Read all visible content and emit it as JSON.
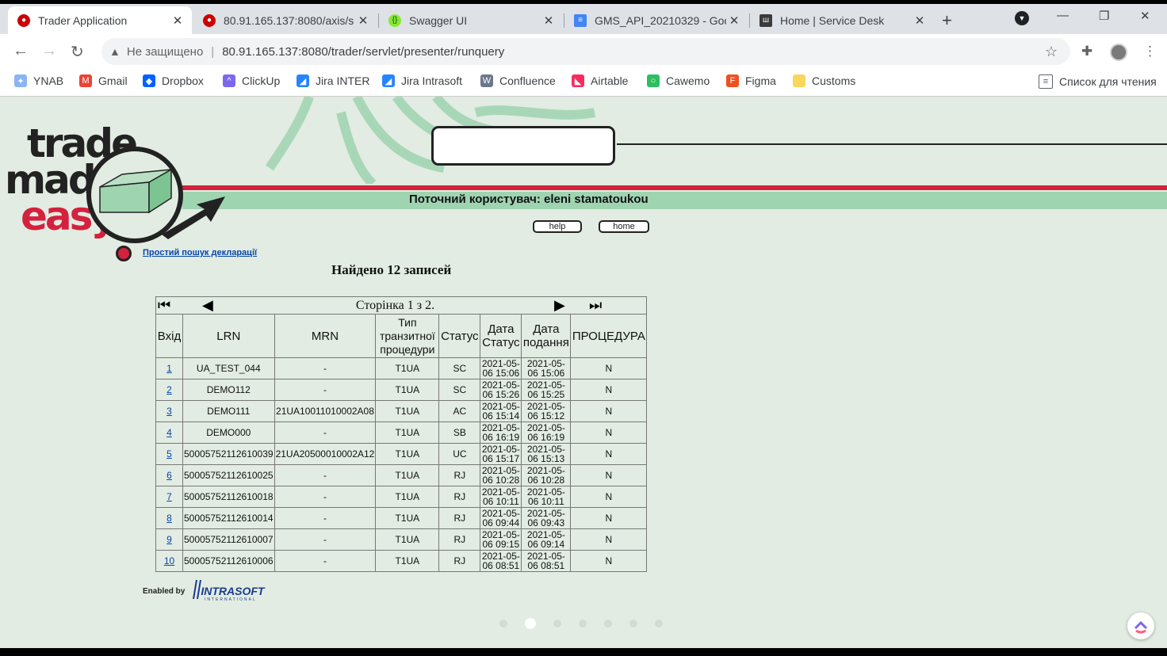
{
  "tabs": [
    {
      "title": "Trader Application",
      "icon": "redhat-icon"
    },
    {
      "title": "80.91.165.137:8080/axis/s",
      "icon": "redhat-icon"
    },
    {
      "title": "Swagger UI",
      "icon": "swagger-icon"
    },
    {
      "title": "GMS_API_20210329 - Goo",
      "icon": "docs-icon"
    },
    {
      "title": "Home | Service Desk",
      "icon": "servicedesk-icon"
    }
  ],
  "toolbar": {
    "security": "Не защищено",
    "url": "80.91.165.137:8080/trader/servlet/presenter/runquery"
  },
  "bookmarks": [
    {
      "label": "YNAB",
      "color": "#8ab4f8"
    },
    {
      "label": "Gmail",
      "color": "#ea4335"
    },
    {
      "label": "Dropbox",
      "color": "#0061ff"
    },
    {
      "label": "ClickUp",
      "color": "#7b68ee"
    },
    {
      "label": "Jira INTER",
      "color": "#2684ff"
    },
    {
      "label": "Jira Intrasoft",
      "color": "#2684ff"
    },
    {
      "label": "Confluence",
      "color": "#6b778c"
    },
    {
      "label": "Airtable",
      "color": "#f82b60"
    },
    {
      "label": "Cawemo",
      "color": "#2dbe60"
    },
    {
      "label": "Figma",
      "color": "#f24e1e"
    },
    {
      "label": "Customs",
      "color": "#f9d65c"
    }
  ],
  "reading_list": "Список для чтения",
  "app": {
    "logo_line1": "trade",
    "logo_line2": "made",
    "logo_line3": "easy",
    "current_user": "Поточний користувач: eleni stamatoukou",
    "help_label": "help",
    "home_label": "home",
    "simple_search_link": "Простий пошук декларації",
    "found_text": "Найдено 12 записей",
    "pager_text": "Сторінка 1 з 2.",
    "enabled_by": "Enabled by",
    "brand": "INTRASOFT",
    "brand_sub": "INTERNATIONAL"
  },
  "table": {
    "headers": [
      "Вхід",
      "LRN",
      "MRN",
      "Тип транзитної процедури",
      "Статус",
      "Дата Статус",
      "Дата подання",
      "ПРОЦЕДУРА"
    ],
    "rows": [
      {
        "n": "1",
        "lrn": "UA_TEST_044",
        "mrn": "-",
        "type": "T1UA",
        "status": "SC",
        "date_status": "2021-05-06 15:06",
        "date_sub": "2021-05-06 15:06",
        "proc": "N"
      },
      {
        "n": "2",
        "lrn": "DEMO112",
        "mrn": "-",
        "type": "T1UA",
        "status": "SC",
        "date_status": "2021-05-06 15:26",
        "date_sub": "2021-05-06 15:25",
        "proc": "N"
      },
      {
        "n": "3",
        "lrn": "DEMO111",
        "mrn": "21UA10011010002A08",
        "type": "T1UA",
        "status": "AC",
        "date_status": "2021-05-06 15:14",
        "date_sub": "2021-05-06 15:12",
        "proc": "N"
      },
      {
        "n": "4",
        "lrn": "DEMO000",
        "mrn": "-",
        "type": "T1UA",
        "status": "SB",
        "date_status": "2021-05-06 16:19",
        "date_sub": "2021-05-06 16:19",
        "proc": "N"
      },
      {
        "n": "5",
        "lrn": "50005752112610039",
        "mrn": "21UA20500010002A12",
        "type": "T1UA",
        "status": "UC",
        "date_status": "2021-05-06 15:17",
        "date_sub": "2021-05-06 15:13",
        "proc": "N"
      },
      {
        "n": "6",
        "lrn": "50005752112610025",
        "mrn": "-",
        "type": "T1UA",
        "status": "RJ",
        "date_status": "2021-05-06 10:28",
        "date_sub": "2021-05-06 10:28",
        "proc": "N"
      },
      {
        "n": "7",
        "lrn": "50005752112610018",
        "mrn": "-",
        "type": "T1UA",
        "status": "RJ",
        "date_status": "2021-05-06 10:11",
        "date_sub": "2021-05-06 10:11",
        "proc": "N"
      },
      {
        "n": "8",
        "lrn": "50005752112610014",
        "mrn": "-",
        "type": "T1UA",
        "status": "RJ",
        "date_status": "2021-05-06 09:44",
        "date_sub": "2021-05-06 09:43",
        "proc": "N"
      },
      {
        "n": "9",
        "lrn": "50005752112610007",
        "mrn": "-",
        "type": "T1UA",
        "status": "RJ",
        "date_status": "2021-05-06 09:15",
        "date_sub": "2021-05-06 09:14",
        "proc": "N"
      },
      {
        "n": "10",
        "lrn": "50005752112610006",
        "mrn": "-",
        "type": "T1UA",
        "status": "RJ",
        "date_status": "2021-05-06 08:51",
        "date_sub": "2021-05-06 08:51",
        "proc": "N"
      }
    ]
  },
  "carousel": {
    "count": 7,
    "active": 1
  }
}
